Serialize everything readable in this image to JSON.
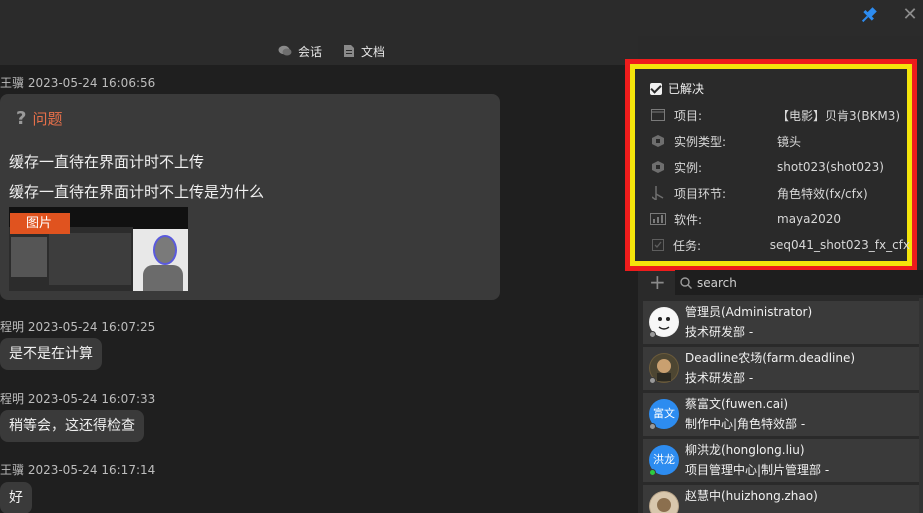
{
  "tabs": {
    "chat": "会话",
    "doc": "文档"
  },
  "messages": [
    {
      "meta": "王骥 2023-05-24 16:06:56"
    },
    {
      "meta": "程明 2023-05-24 16:07:25",
      "text": "是不是在计算"
    },
    {
      "meta": "程明 2023-05-24 16:07:33",
      "text": "稍等会，这还得检查"
    },
    {
      "meta": "王骥 2023-05-24 16:17:14",
      "text": "好"
    }
  ],
  "question": {
    "title": "问题",
    "line1": "缓存一直待在界面计时不上传",
    "line2": "缓存一直待在界面计时不上传是为什么",
    "image_tag": "图片"
  },
  "info": {
    "resolved_label": "已解决",
    "rows": [
      {
        "icon": "window-icon",
        "label": "项目:",
        "value": "【电影】贝肯3(BKM3)"
      },
      {
        "icon": "cube-icon",
        "label": "实例类型:",
        "value": "镜头"
      },
      {
        "icon": "cube-icon",
        "label": "实例:",
        "value": "shot023(shot023)"
      },
      {
        "icon": "branch-icon",
        "label": "项目环节:",
        "value": "角色特效(fx/cfx)"
      },
      {
        "icon": "bar-chart-icon",
        "label": "软件:",
        "value": "maya2020"
      },
      {
        "icon": "checkbox-icon",
        "label": "任务:",
        "value": "seq041_shot023_fx_cfx"
      }
    ]
  },
  "search": {
    "placeholder": "search"
  },
  "members": [
    {
      "name": "管理员(Administrator)",
      "dept": "技术研发部 -",
      "avatar_text": "",
      "status": "offline"
    },
    {
      "name": "Deadline农场(farm.deadline)",
      "dept": "技术研发部 -",
      "avatar_text": "",
      "status": "offline"
    },
    {
      "name": "蔡富文(fuwen.cai)",
      "dept": "制作中心|角色特效部 -",
      "avatar_text": "富文",
      "status": "offline"
    },
    {
      "name": "柳洪龙(honglong.liu)",
      "dept": "项目管理中心|制片管理部 -",
      "avatar_text": "洪龙",
      "status": "online"
    },
    {
      "name": "赵慧中(huizhong.zhao)",
      "dept": "",
      "avatar_text": "",
      "status": "offline"
    }
  ],
  "colors": {
    "accent_orange": "#e0531f",
    "avatar_blue": "#2d8cf0",
    "highlight_red": "#ee1c1c",
    "highlight_yellow": "#f4e40b",
    "pin_blue": "#2d8cf0"
  }
}
